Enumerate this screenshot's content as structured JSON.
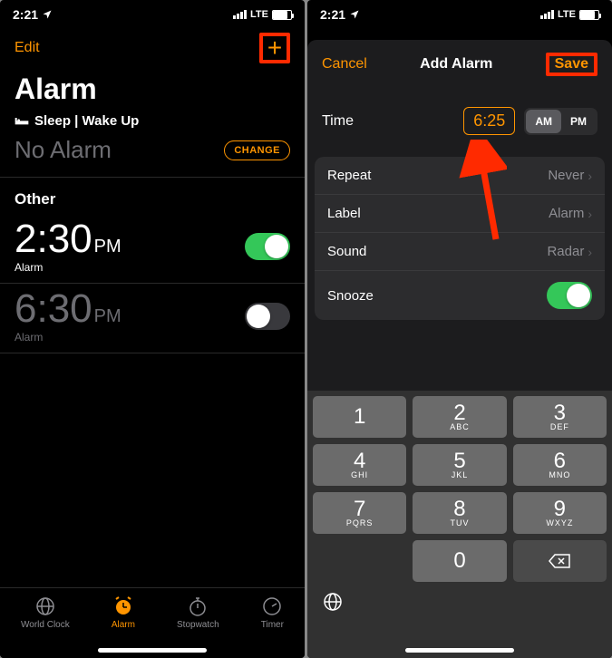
{
  "status": {
    "time": "2:21",
    "network": "LTE"
  },
  "left": {
    "edit": "Edit",
    "title": "Alarm",
    "sleep_label": "Sleep | Wake Up",
    "no_alarm": "No Alarm",
    "change": "CHANGE",
    "other": "Other",
    "alarms": [
      {
        "time": "2:30",
        "ampm": "PM",
        "label": "Alarm",
        "on": true
      },
      {
        "time": "6:30",
        "ampm": "PM",
        "label": "Alarm",
        "on": false
      }
    ],
    "tabs": {
      "world": "World Clock",
      "alarm": "Alarm",
      "stopwatch": "Stopwatch",
      "timer": "Timer"
    }
  },
  "right": {
    "cancel": "Cancel",
    "title": "Add Alarm",
    "save": "Save",
    "time_label": "Time",
    "time_value": "6:25",
    "am": "AM",
    "pm": "PM",
    "rows": {
      "repeat_label": "Repeat",
      "repeat_val": "Never",
      "label_label": "Label",
      "label_val": "Alarm",
      "sound_label": "Sound",
      "sound_val": "Radar",
      "snooze_label": "Snooze"
    },
    "keypad": {
      "1": "1",
      "2": "2",
      "3": "3",
      "4": "4",
      "5": "5",
      "6": "6",
      "7": "7",
      "8": "8",
      "9": "9",
      "0": "0",
      "abc": "ABC",
      "def": "DEF",
      "ghi": "GHI",
      "jkl": "JKL",
      "mno": "MNO",
      "pqrs": "PQRS",
      "tuv": "TUV",
      "wxyz": "WXYZ"
    }
  }
}
